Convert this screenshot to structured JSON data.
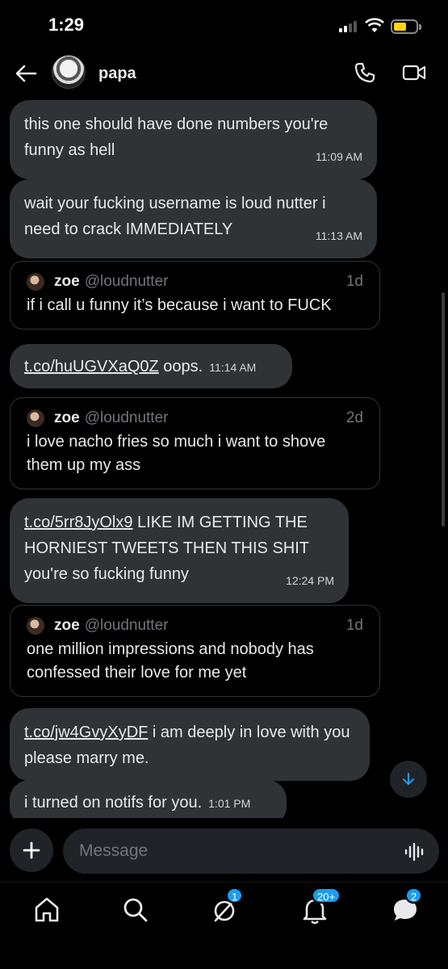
{
  "status_bar": {
    "time": "1:29"
  },
  "header": {
    "name": "papa"
  },
  "messages": [
    {
      "text": "this one should have done numbers you're funny as hell",
      "time": "11:09 AM"
    },
    {
      "text": "wait your fucking username is loud nutter i need to crack IMMEDIATELY",
      "time": "11:13 AM"
    },
    {
      "quote": {
        "name": "zoe",
        "handle": "@loudnutter",
        "age": "1d",
        "text": "if i call u funny it’s because i want to FUCK"
      }
    },
    {
      "link": "t.co/huUGVXaQ0Z",
      "text": " oops.",
      "time": "11:14 AM"
    },
    {
      "quote": {
        "name": "zoe",
        "handle": "@loudnutter",
        "age": "2d",
        "text": "i love nacho fries so much i want to shove them up my ass"
      }
    },
    {
      "link": "t.co/5rr8JyOlx9",
      "text": " LIKE IM GETTING THE HORNIEST TWEETS THEN THIS SHIT you're so fucking funny",
      "time": "12:24 PM"
    },
    {
      "quote": {
        "name": "zoe",
        "handle": "@loudnutter",
        "age": "1d",
        "text": "one million impressions and nobody has confessed their love for me yet"
      }
    },
    {
      "link": "t.co/jw4GvyXyDF",
      "text": " i am deeply in love with you please marry me."
    },
    {
      "text": "i turned on notifs for you.",
      "time": "1:01 PM"
    }
  ],
  "composer": {
    "placeholder": "Message"
  },
  "nav": {
    "messages_badge": "1",
    "notifications_badge": "20+",
    "grok_badge": "2"
  },
  "colors": {
    "accent": "#1d9bf0",
    "bubble": "#2f3336",
    "background": "#000000"
  }
}
